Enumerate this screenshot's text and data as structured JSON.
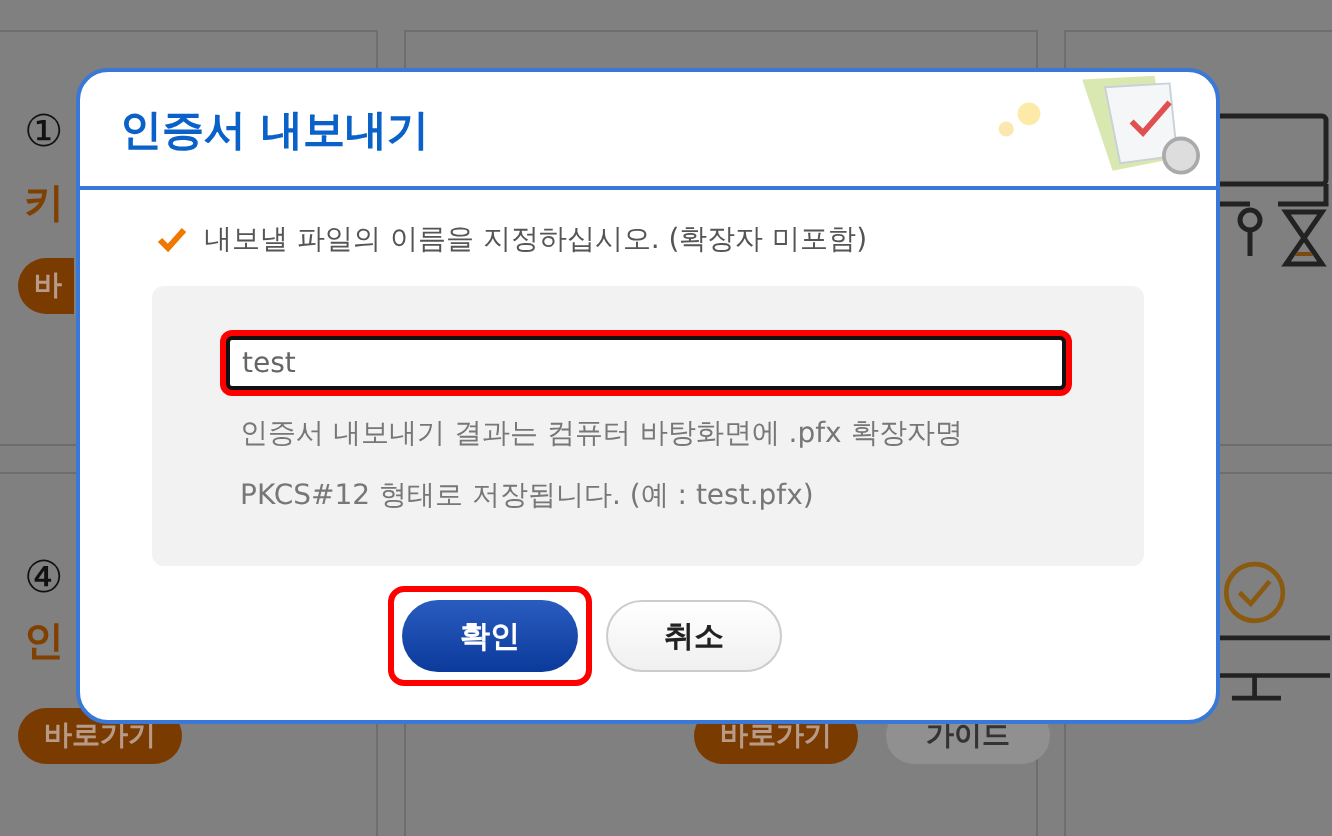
{
  "background": {
    "cards": [
      {
        "kind": "text",
        "marker": "①",
        "title": "키",
        "buttons": [
          {
            "label": "바",
            "kind": "primary"
          }
        ]
      },
      {
        "kind": "blank"
      },
      {
        "kind": "icon"
      },
      {
        "kind": "text",
        "marker": "④",
        "title": "인",
        "buttons": [
          {
            "label": "바로가기",
            "kind": "primary"
          }
        ]
      },
      {
        "kind": "text",
        "buttons": [
          {
            "label": "바로가기",
            "kind": "primary"
          },
          {
            "label": "가이드",
            "kind": "secondary"
          }
        ]
      },
      {
        "kind": "icon"
      }
    ]
  },
  "dialog": {
    "title": "인증서 내보내기",
    "instruction": "내보낼 파일의 이름을 지정하십시오. (확장자 미포함)",
    "field": {
      "value": "test",
      "highlighted": true
    },
    "help": [
      "인증서 내보내기 결과는 컴퓨터 바탕화면에 .pfx 확장자명",
      "PKCS#12 형태로 저장됩니다. (예 : test.pfx)"
    ],
    "buttons": [
      {
        "label": "확인",
        "kind": "primary",
        "highlighted": true
      },
      {
        "label": "취소",
        "kind": "secondary",
        "highlighted": false
      }
    ]
  }
}
